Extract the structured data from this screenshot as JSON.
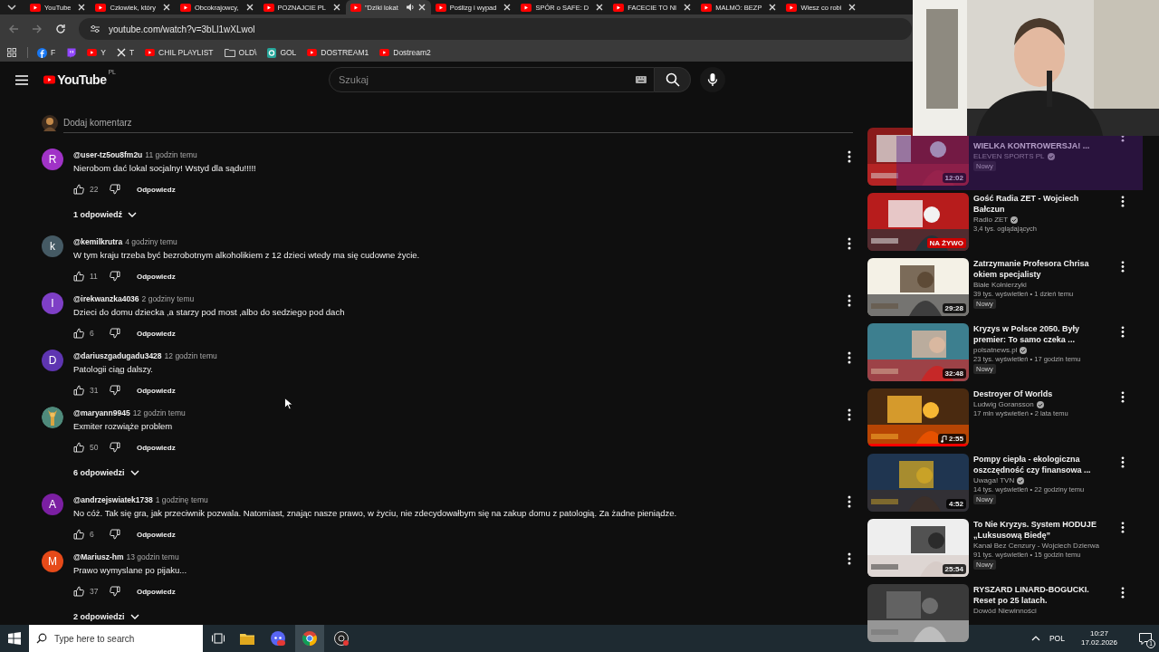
{
  "browser": {
    "tabs": [
      {
        "title": "YouTube",
        "selected": false,
        "audio": false
      },
      {
        "title": "Człowiek, który",
        "selected": false,
        "audio": false
      },
      {
        "title": "Obcokrajowcy,",
        "selected": false,
        "audio": false
      },
      {
        "title": "POZNAJCIE PL",
        "selected": false,
        "audio": false
      },
      {
        "title": "\"Dziki lokat",
        "selected": true,
        "audio": true
      },
      {
        "title": "Poślizg i wypad",
        "selected": false,
        "audio": false
      },
      {
        "title": "SPÓR o SAFE: D",
        "selected": false,
        "audio": false
      },
      {
        "title": "FACECIE TO NI",
        "selected": false,
        "audio": false
      },
      {
        "title": "MALMÖ: BEZP",
        "selected": false,
        "audio": false
      },
      {
        "title": "Wiesz co robi",
        "selected": false,
        "audio": false
      }
    ],
    "url": "youtube.com/watch?v=3bLl1wXLwol",
    "bookmarks": [
      {
        "kind": "facebook",
        "label": "F"
      },
      {
        "kind": "twitch"
      },
      {
        "kind": "youtube",
        "label": "Y"
      },
      {
        "kind": "x",
        "label": "T"
      },
      {
        "kind": "youtube",
        "label": "CHIL PLAYLIST"
      },
      {
        "kind": "folder",
        "label": "OLD\\"
      },
      {
        "kind": "gol",
        "label": "GOL"
      },
      {
        "kind": "youtube",
        "label": "DOSTREAM1"
      },
      {
        "kind": "youtube",
        "label": "Dostream2"
      }
    ]
  },
  "youtube": {
    "logo": "YouTube",
    "region": "PL",
    "search": {
      "placeholder": "Szukaj"
    }
  },
  "comments": {
    "add_placeholder": "Dodaj komentarz",
    "items": [
      {
        "author": "@user-tz5ou8fm2u",
        "time": "11 godzin temu",
        "text": "Nierobom dać lokal socjalny! Wstyd dla sądu!!!!!",
        "likes": "22",
        "reply": "Odpowiedz",
        "avatar": {
          "letter": "R",
          "color": "#a033c7"
        },
        "replies": "1 odpowiedź"
      },
      {
        "author": "@kemilkrutra",
        "time": "4 godziny temu",
        "text": "W tym kraju trzeba być bezrobotnym alkoholikiem z 12 dzieci wtedy ma się cudowne życie.",
        "likes": "11",
        "reply": "Odpowiedz",
        "avatar": {
          "letter": "k",
          "color": "#455a64"
        }
      },
      {
        "author": "@irekwanzka4036",
        "time": "2 godziny temu",
        "text": "Dzieci do domu dziecka ,a starzy pod most ,albo do sedziego pod dach",
        "likes": "6",
        "reply": "Odpowiedz",
        "avatar": {
          "letter": "I",
          "color": "#7e3fc6"
        }
      },
      {
        "author": "@dariuszgadugadu3428",
        "time": "12 godzin temu",
        "text": "Patologii ciąg dalszy.",
        "likes": "31",
        "reply": "Odpowiedz",
        "avatar": {
          "letter": "D",
          "color": "#5e35b1"
        }
      },
      {
        "author": "@maryann9945",
        "time": "12 godzin temu",
        "text": "Exmiter rozwiąże problem",
        "likes": "50",
        "reply": "Odpowiedz",
        "replies": "6 odpowiedzi"
      },
      {
        "author": "@andrzejswiatek1738",
        "time": "1 godzinę temu",
        "text": "No cóż. Tak się gra, jak przeciwnik pozwala. Natomiast, znając nasze prawo, w życiu, nie zdecydowałbym się na zakup domu z patologią. Za żadne pieniądze.",
        "likes": "6",
        "reply": "Odpowiedz",
        "avatar": {
          "letter": "A",
          "color": "#7b1fa2"
        }
      },
      {
        "author": "@Mariusz-hm",
        "time": "13 godzin temu",
        "text": "Prawo wymyslane po pijaku...",
        "likes": "37",
        "reply": "Odpowiedz",
        "avatar": {
          "letter": "M",
          "color": "#e64a19"
        },
        "replies": "2 odpowiedzi"
      }
    ]
  },
  "sidebar": {
    "videos": [
      {
        "title": "WIELKA KONTROWERSJA! ...",
        "channel": "ELEVEN SPORTS PL",
        "verified": true,
        "duration": "12:02",
        "badge": "Nowy"
      },
      {
        "title": "Gość Radia ZET - Wojciech Bałczun",
        "channel": "Radio ZET",
        "verified": true,
        "meta": "3,4 tys. oglądających",
        "live": "NA ŻYWO"
      },
      {
        "title": "Zatrzymanie Profesora Chrisa okiem specjalisty",
        "channel": "Białe Kołnierzyki",
        "verified": false,
        "meta": "39 tys. wyświetleń • 1 dzień temu",
        "badge": "Nowy",
        "duration": "29:28"
      },
      {
        "title": "Kryzys w Polsce 2050. Były premier: To samo czeka ...",
        "channel": "polsatnews.pl",
        "verified": true,
        "meta": "23 tys. wyświetleń • 17 godzin temu",
        "badge": "Nowy",
        "duration": "32:48"
      },
      {
        "title": "Destroyer Of Worlds",
        "channel": "Ludwig Goransson",
        "verified": true,
        "meta": "17 mln wyświetleń • 2 lata temu",
        "duration": "2:55",
        "music": true,
        "level": 1
      },
      {
        "title": "Pompy ciepła - ekologiczna oszczędność czy finansowa ...",
        "channel": "Uwaga! TVN",
        "verified": true,
        "meta": "14 tys. wyświetleń • 22 godziny temu",
        "badge": "Nowy",
        "duration": "4:52"
      },
      {
        "title": "To Nie Kryzys. System HODUJE „Luksusową Biedę”",
        "channel": "Kanał Bez Cenzury - Wojciech Dzierwa",
        "verified": false,
        "meta": "91 tys. wyświetleń • 15 godzin temu",
        "badge": "Nowy",
        "duration": "25:54"
      },
      {
        "title": "RYSZARD LINARD-BOGUCKI. Reset po 25 latach.",
        "channel": "Dowód Niewinności",
        "verified": false
      }
    ]
  },
  "taskbar": {
    "search_placeholder": "Type here to search",
    "language": "POL",
    "time": "10:27",
    "date": "17.02.2026",
    "notifications": "1"
  }
}
